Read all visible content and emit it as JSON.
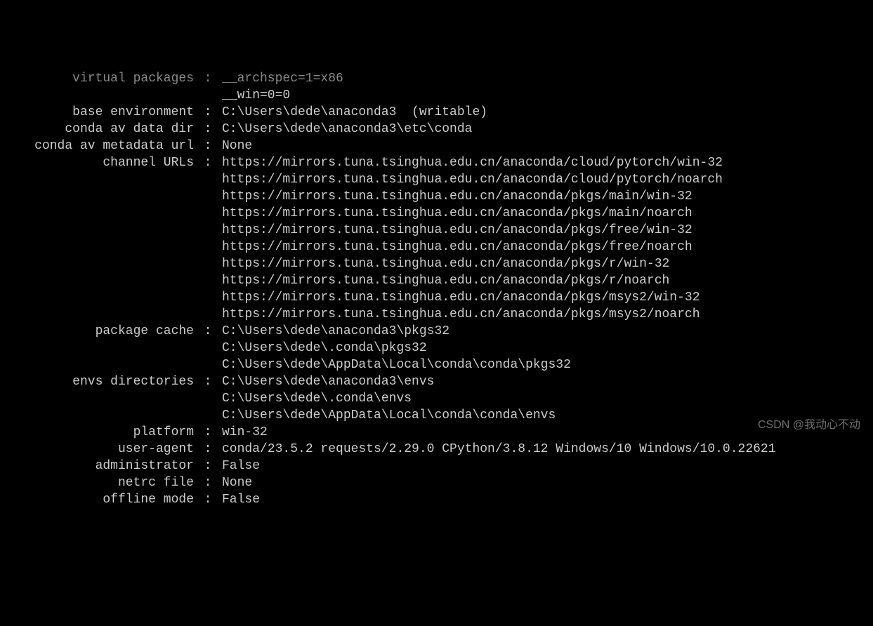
{
  "rows": [
    {
      "label": "virtual packages",
      "values": [
        "__archspec=1=x86",
        "__win=0=0"
      ],
      "dim_first": true
    },
    {
      "label": "base environment",
      "values": [
        "C:\\Users\\dede\\anaconda3  (writable)"
      ]
    },
    {
      "label": "conda av data dir",
      "values": [
        "C:\\Users\\dede\\anaconda3\\etc\\conda"
      ]
    },
    {
      "label": "conda av metadata url",
      "values": [
        "None"
      ]
    },
    {
      "label": "channel URLs",
      "values": [
        "https://mirrors.tuna.tsinghua.edu.cn/anaconda/cloud/pytorch/win-32",
        "https://mirrors.tuna.tsinghua.edu.cn/anaconda/cloud/pytorch/noarch",
        "https://mirrors.tuna.tsinghua.edu.cn/anaconda/pkgs/main/win-32",
        "https://mirrors.tuna.tsinghua.edu.cn/anaconda/pkgs/main/noarch",
        "https://mirrors.tuna.tsinghua.edu.cn/anaconda/pkgs/free/win-32",
        "https://mirrors.tuna.tsinghua.edu.cn/anaconda/pkgs/free/noarch",
        "https://mirrors.tuna.tsinghua.edu.cn/anaconda/pkgs/r/win-32",
        "https://mirrors.tuna.tsinghua.edu.cn/anaconda/pkgs/r/noarch",
        "https://mirrors.tuna.tsinghua.edu.cn/anaconda/pkgs/msys2/win-32",
        "https://mirrors.tuna.tsinghua.edu.cn/anaconda/pkgs/msys2/noarch"
      ]
    },
    {
      "label": "package cache",
      "values": [
        "C:\\Users\\dede\\anaconda3\\pkgs32",
        "C:\\Users\\dede\\.conda\\pkgs32",
        "C:\\Users\\dede\\AppData\\Local\\conda\\conda\\pkgs32"
      ]
    },
    {
      "label": "envs directories",
      "values": [
        "C:\\Users\\dede\\anaconda3\\envs",
        "C:\\Users\\dede\\.conda\\envs",
        "C:\\Users\\dede\\AppData\\Local\\conda\\conda\\envs"
      ]
    },
    {
      "label": "platform",
      "values": [
        "win-32"
      ]
    },
    {
      "label": "user-agent",
      "values": [
        "conda/23.5.2 requests/2.29.0 CPython/3.8.12 Windows/10 Windows/10.0.22621"
      ]
    },
    {
      "label": "administrator",
      "values": [
        "False"
      ]
    },
    {
      "label": "netrc file",
      "values": [
        "None"
      ]
    },
    {
      "label": "offline mode",
      "values": [
        "False"
      ]
    }
  ],
  "separator": " : ",
  "watermark": "CSDN @我动心不动"
}
